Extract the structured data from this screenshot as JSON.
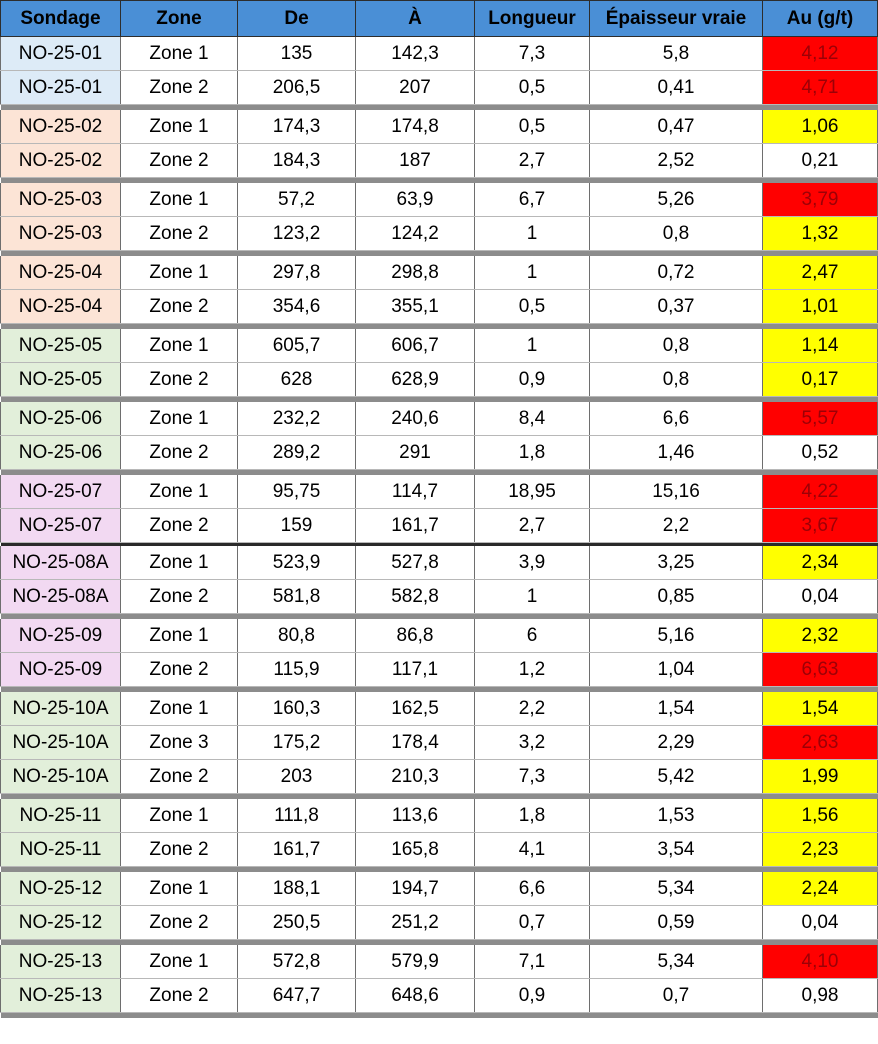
{
  "headers": [
    "Sondage",
    "Zone",
    "De",
    "À",
    "Longueur",
    "Épaisseur vraie",
    "Au (g/t)"
  ],
  "colors": {
    "header": "#4a8fd6",
    "au_high": "#ff0000",
    "au_medium": "#ffff00",
    "hole_blue": "#ddebf7",
    "hole_orange": "#fce4d6",
    "hole_green": "#e2efda",
    "hole_pink": "#f2d9f2"
  },
  "rows": [
    {
      "sondage": "NO-25-01",
      "zone": "Zone 1",
      "de": "135",
      "a": "142,3",
      "longueur": "7,3",
      "epaisseur": "5,8",
      "au": "4,12",
      "hole_color": "#ddebf7",
      "au_level": "high"
    },
    {
      "sondage": "NO-25-01",
      "zone": "Zone 2",
      "de": "206,5",
      "a": "207",
      "longueur": "0,5",
      "epaisseur": "0,41",
      "au": "4,71",
      "hole_color": "#ddebf7",
      "au_level": "high"
    },
    {
      "sondage": "NO-25-02",
      "zone": "Zone 1",
      "de": "174,3",
      "a": "174,8",
      "longueur": "0,5",
      "epaisseur": "0,47",
      "au": "1,06",
      "hole_color": "#fce4d6",
      "au_level": "medium"
    },
    {
      "sondage": "NO-25-02",
      "zone": "Zone 2",
      "de": "184,3",
      "a": "187",
      "longueur": "2,7",
      "epaisseur": "2,52",
      "au": "0,21",
      "hole_color": "#fce4d6",
      "au_level": "low"
    },
    {
      "sondage": "NO-25-03",
      "zone": "Zone 1",
      "de": "57,2",
      "a": "63,9",
      "longueur": "6,7",
      "epaisseur": "5,26",
      "au": "3,79",
      "hole_color": "#fce4d6",
      "au_level": "high"
    },
    {
      "sondage": "NO-25-03",
      "zone": "Zone 2",
      "de": "123,2",
      "a": "124,2",
      "longueur": "1",
      "epaisseur": "0,8",
      "au": "1,32",
      "hole_color": "#fce4d6",
      "au_level": "medium"
    },
    {
      "sondage": "NO-25-04",
      "zone": "Zone 1",
      "de": "297,8",
      "a": "298,8",
      "longueur": "1",
      "epaisseur": "0,72",
      "au": "2,47",
      "hole_color": "#fce4d6",
      "au_level": "medium"
    },
    {
      "sondage": "NO-25-04",
      "zone": "Zone 2",
      "de": "354,6",
      "a": "355,1",
      "longueur": "0,5",
      "epaisseur": "0,37",
      "au": "1,01",
      "hole_color": "#fce4d6",
      "au_level": "medium"
    },
    {
      "sondage": "NO-25-05",
      "zone": "Zone 1",
      "de": "605,7",
      "a": "606,7",
      "longueur": "1",
      "epaisseur": "0,8",
      "au": "1,14",
      "hole_color": "#e2efda",
      "au_level": "medium"
    },
    {
      "sondage": "NO-25-05",
      "zone": "Zone 2",
      "de": "628",
      "a": "628,9",
      "longueur": "0,9",
      "epaisseur": "0,8",
      "au": "0,17",
      "hole_color": "#e2efda",
      "au_level": "medium"
    },
    {
      "sondage": "NO-25-06",
      "zone": "Zone 1",
      "de": "232,2",
      "a": "240,6",
      "longueur": "8,4",
      "epaisseur": "6,6",
      "au": "5,57",
      "hole_color": "#e2efda",
      "au_level": "high"
    },
    {
      "sondage": "NO-25-06",
      "zone": "Zone 2",
      "de": "289,2",
      "a": "291",
      "longueur": "1,8",
      "epaisseur": "1,46",
      "au": "0,52",
      "hole_color": "#e2efda",
      "au_level": "low"
    },
    {
      "sondage": "NO-25-07",
      "zone": "Zone 1",
      "de": "95,75",
      "a": "114,7",
      "longueur": "18,95",
      "epaisseur": "15,16",
      "au": "4,22",
      "hole_color": "#f2d9f2",
      "au_level": "high"
    },
    {
      "sondage": "NO-25-07",
      "zone": "Zone 2",
      "de": "159",
      "a": "161,7",
      "longueur": "2,7",
      "epaisseur": "2,2",
      "au": "3,67",
      "hole_color": "#f2d9f2",
      "au_level": "high"
    },
    {
      "sondage": "NO-25-08A",
      "zone": "Zone 1",
      "de": "523,9",
      "a": "527,8",
      "longueur": "3,9",
      "epaisseur": "3,25",
      "au": "2,34",
      "hole_color": "#f2d9f2",
      "au_level": "medium"
    },
    {
      "sondage": "NO-25-08A",
      "zone": "Zone 2",
      "de": "581,8",
      "a": "582,8",
      "longueur": "1",
      "epaisseur": "0,85",
      "au": "0,04",
      "hole_color": "#f2d9f2",
      "au_level": "low"
    },
    {
      "sondage": "NO-25-09",
      "zone": "Zone 1",
      "de": "80,8",
      "a": "86,8",
      "longueur": "6",
      "epaisseur": "5,16",
      "au": "2,32",
      "hole_color": "#f2d9f2",
      "au_level": "medium"
    },
    {
      "sondage": "NO-25-09",
      "zone": "Zone 2",
      "de": "115,9",
      "a": "117,1",
      "longueur": "1,2",
      "epaisseur": "1,04",
      "au": "6,63",
      "hole_color": "#f2d9f2",
      "au_level": "high"
    },
    {
      "sondage": "NO-25-10A",
      "zone": "Zone 1",
      "de": "160,3",
      "a": "162,5",
      "longueur": "2,2",
      "epaisseur": "1,54",
      "au": "1,54",
      "hole_color": "#e2efda",
      "au_level": "medium"
    },
    {
      "sondage": "NO-25-10A",
      "zone": "Zone 3",
      "de": "175,2",
      "a": "178,4",
      "longueur": "3,2",
      "epaisseur": "2,29",
      "au": "2,63",
      "hole_color": "#e2efda",
      "au_level": "high"
    },
    {
      "sondage": "NO-25-10A",
      "zone": "Zone 2",
      "de": "203",
      "a": "210,3",
      "longueur": "7,3",
      "epaisseur": "5,42",
      "au": "1,99",
      "hole_color": "#e2efda",
      "au_level": "medium"
    },
    {
      "sondage": "NO-25-11",
      "zone": "Zone 1",
      "de": "111,8",
      "a": "113,6",
      "longueur": "1,8",
      "epaisseur": "1,53",
      "au": "1,56",
      "hole_color": "#e2efda",
      "au_level": "medium"
    },
    {
      "sondage": "NO-25-11",
      "zone": "Zone 2",
      "de": "161,7",
      "a": "165,8",
      "longueur": "4,1",
      "epaisseur": "3,54",
      "au": "2,23",
      "hole_color": "#e2efda",
      "au_level": "medium"
    },
    {
      "sondage": "NO-25-12",
      "zone": "Zone 1",
      "de": "188,1",
      "a": "194,7",
      "longueur": "6,6",
      "epaisseur": "5,34",
      "au": "2,24",
      "hole_color": "#e2efda",
      "au_level": "medium"
    },
    {
      "sondage": "NO-25-12",
      "zone": "Zone 2",
      "de": "250,5",
      "a": "251,2",
      "longueur": "0,7",
      "epaisseur": "0,59",
      "au": "0,04",
      "hole_color": "#e2efda",
      "au_level": "low"
    },
    {
      "sondage": "NO-25-13",
      "zone": "Zone 1",
      "de": "572,8",
      "a": "579,9",
      "longueur": "7,1",
      "epaisseur": "5,34",
      "au": "4,10",
      "hole_color": "#e2efda",
      "au_level": "high"
    },
    {
      "sondage": "NO-25-13",
      "zone": "Zone 2",
      "de": "647,7",
      "a": "648,6",
      "longueur": "0,9",
      "epaisseur": "0,7",
      "au": "0,98",
      "hole_color": "#e2efda",
      "au_level": "low"
    }
  ],
  "separators_after": [
    1,
    3,
    5,
    7,
    9,
    11,
    13,
    15,
    17,
    20,
    22,
    24,
    26
  ],
  "black_separators_after": [
    13
  ]
}
